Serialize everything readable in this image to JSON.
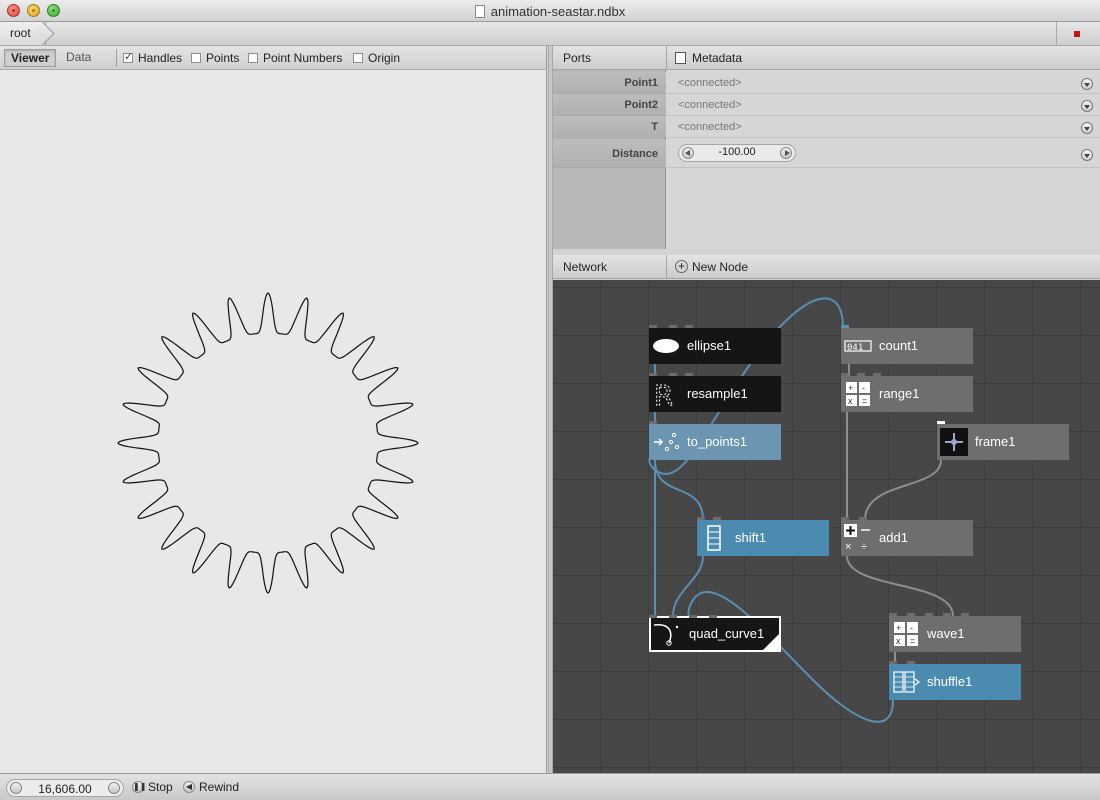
{
  "window": {
    "title": "animation-seastar.ndbx"
  },
  "breadcrumb": {
    "root": "root"
  },
  "viewer": {
    "tabs": [
      "Viewer",
      "Data"
    ],
    "options": [
      {
        "label": "Handles",
        "checked": true
      },
      {
        "label": "Points",
        "checked": false
      },
      {
        "label": "Point Numbers",
        "checked": false
      },
      {
        "label": "Origin",
        "checked": false
      }
    ]
  },
  "ports_panel": {
    "title": "Ports",
    "metadata_label": "Metadata",
    "rows": [
      {
        "label": "Point1",
        "value": "<connected>"
      },
      {
        "label": "Point2",
        "value": "<connected>"
      },
      {
        "label": "T",
        "value": "<connected>"
      },
      {
        "label": "Distance",
        "value": "-100.00"
      }
    ]
  },
  "network_panel": {
    "title": "Network",
    "new_node_label": "New Node",
    "nodes": [
      {
        "name": "ellipse1",
        "style": "black"
      },
      {
        "name": "count1",
        "style": "gray"
      },
      {
        "name": "resample1",
        "style": "black"
      },
      {
        "name": "range1",
        "style": "gray"
      },
      {
        "name": "to_points1",
        "style": "lightblue"
      },
      {
        "name": "frame1",
        "style": "gray"
      },
      {
        "name": "shift1",
        "style": "blue"
      },
      {
        "name": "add1",
        "style": "gray"
      },
      {
        "name": "quad_curve1",
        "style": "black"
      },
      {
        "name": "wave1",
        "style": "gray"
      },
      {
        "name": "shuffle1",
        "style": "blue"
      }
    ]
  },
  "playback": {
    "frame": "16,606.00",
    "stop_label": "Stop",
    "rewind_label": "Rewind"
  },
  "colors": {
    "connection": "#5a8fb3",
    "gray_connection": "#8e8e8e",
    "node_black": "#151515",
    "node_gray": "#6e6e6e",
    "node_blue": "#4b8bb0",
    "stop_indicator": "#c01515"
  }
}
